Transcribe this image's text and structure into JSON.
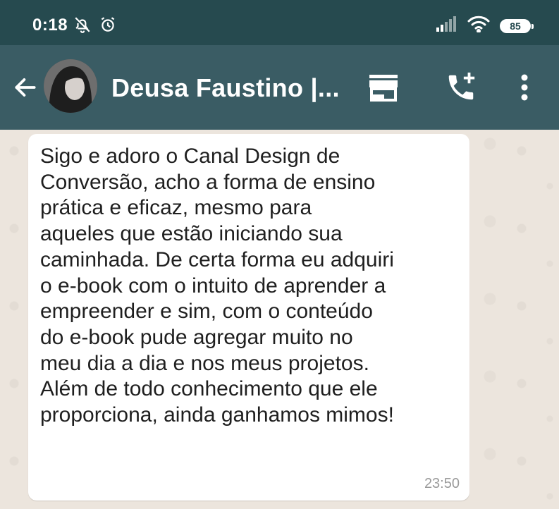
{
  "status_bar": {
    "time": "0:18",
    "battery": "85",
    "icons": [
      "notifications-off-icon",
      "alarm-icon",
      "signal-icon",
      "wifi-icon",
      "battery-icon"
    ]
  },
  "app_bar": {
    "contact_name": "Deusa Faustino |...",
    "icons": [
      "back-arrow-icon",
      "store-icon",
      "add-call-icon",
      "more-vert-icon"
    ]
  },
  "chat": {
    "message": {
      "text": "Sigo e adoro o Canal Design de\nConversão, acho a forma de ensino\nprática e eficaz, mesmo para\naqueles que estão iniciando sua\ncaminhada. De certa forma eu adquiri\no e-book com o intuito de aprender a\nempreender e sim, com o conteúdo\ndo e-book pude agregar muito no\nmeu dia a dia e nos meus projetos.\nAlém de todo conhecimento que ele\nproporciona, ainda ganhamos mimos!",
      "time": "23:50"
    }
  },
  "colors": {
    "status_bar_bg": "#264a4f",
    "app_bar_bg": "#3a5c64",
    "chat_bg": "#ece5dd",
    "bubble_bg": "#ffffff",
    "timestamp": "#9a9a9a"
  }
}
